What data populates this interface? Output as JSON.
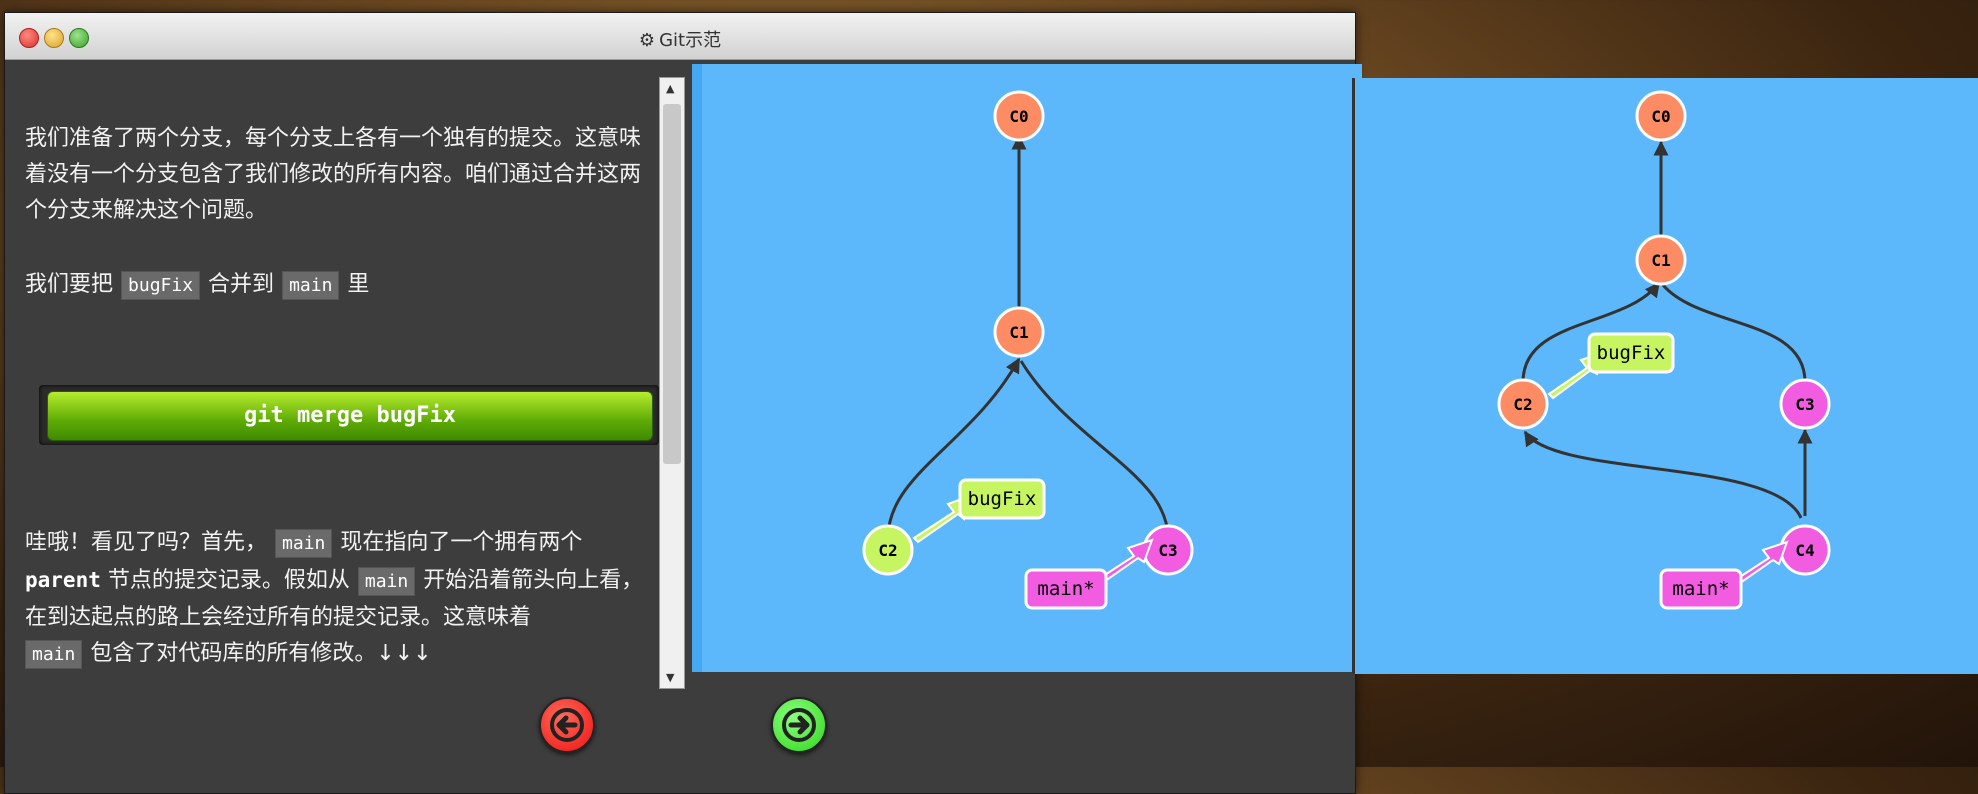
{
  "window": {
    "title": "Git示范",
    "title_icon": "gear-icon"
  },
  "text": {
    "p1": "我们准备了两个分支，每个分支上各有一个独有的提交。这意味着没有一个分支包含了我们修改的所有内容。咱们通过合并这两个分支来解决这个问题。",
    "p2_before": "我们要把",
    "p2_code1": "bugFix",
    "p2_mid": "合并到",
    "p2_code2": "main",
    "p2_after": "里",
    "p3_a": "哇哦！看见了吗？首先，",
    "p3_code1": "main",
    "p3_b": "现在指向了一个拥有两个",
    "p3_code2": "parent",
    "p3_c": "节点的提交记录。假如从",
    "p3_code3": "main",
    "p3_d": "开始沿着箭头向上看，在到达起点的路上会经过所有的提交记录。这意味着",
    "p3_code4": "main",
    "p3_e": "包含了对代码库的所有修改。↓↓↓"
  },
  "command": {
    "label": "git merge bugFix"
  },
  "nav": {
    "prev_icon": "arrow-left-icon",
    "next_icon": "arrow-right-icon"
  },
  "graph_before": {
    "commits": [
      "C0",
      "C1",
      "C2",
      "C3"
    ],
    "branches": {
      "bugFix": "bugFix",
      "main": "main*"
    }
  },
  "graph_after": {
    "commits": [
      "C0",
      "C1",
      "C2",
      "C3",
      "C4"
    ],
    "branches": {
      "bugFix": "bugFix",
      "main": "main*"
    }
  },
  "colors": {
    "commit": "#fd8b63",
    "commit_branch": "#f15ce0",
    "bugfix": "#c7f461",
    "main": "#f15ce0",
    "canvas": "#5cb8fb"
  }
}
